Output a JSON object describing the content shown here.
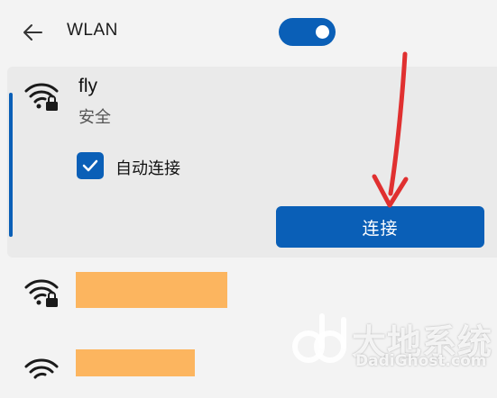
{
  "header": {
    "back_icon": "arrow-left-icon",
    "title": "WLAN",
    "toggle_state": "on"
  },
  "networks": [
    {
      "name": "fly",
      "status": "安全",
      "icon": "wifi-secured-icon",
      "expanded": true,
      "auto_connect_label": "自动连接",
      "auto_connect_checked": true,
      "connect_label": "连接"
    },
    {
      "name_redacted": true,
      "icon": "wifi-secured-icon"
    },
    {
      "name_redacted": true,
      "icon": "wifi-secured-icon"
    }
  ],
  "annotation": {
    "type": "red-arrow",
    "color": "#e03030"
  },
  "watermark": {
    "text_cn": "大地系统",
    "text_en": "DadiGhost.com"
  },
  "colors": {
    "accent": "#0a5fb7",
    "background": "#f3f3f3",
    "expanded_bg": "#eaeaea",
    "redaction": "#fcb55f"
  }
}
